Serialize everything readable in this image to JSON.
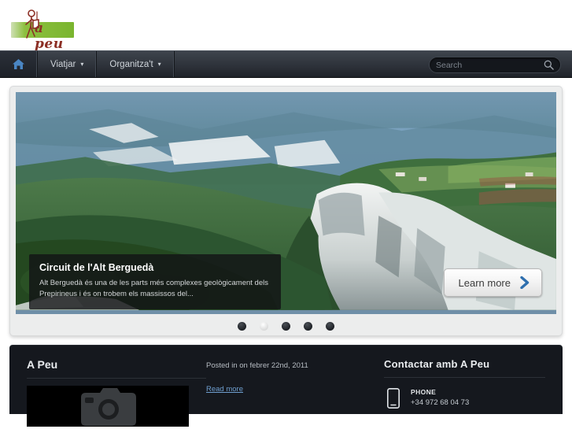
{
  "site": {
    "logo_text": "a peu",
    "logo_accent": "#7ab52f",
    "logo_ink": "#8c2f25"
  },
  "nav": {
    "home_icon": "home-icon",
    "items": [
      {
        "label": "Viatjar",
        "caret": "▾"
      },
      {
        "label": "Organitza't",
        "caret": "▾"
      }
    ]
  },
  "search": {
    "placeholder": "Search",
    "value": "",
    "icon": "search-icon"
  },
  "slider": {
    "caption_title": "Circuit de l'Alt Berguedà",
    "caption_text": "Alt Berguedà és una de les parts més complexes geològicament dels Prepirineus i és on trobem els massissos del...",
    "learn_more_label": "Learn more",
    "learn_more_icon": "chevron-right-icon",
    "arrow_color": "#2f6fae",
    "dots": [
      {
        "active": false
      },
      {
        "active": true
      },
      {
        "active": false
      },
      {
        "active": false
      },
      {
        "active": false
      }
    ]
  },
  "post": {
    "title": "A Peu",
    "thumbnail_icon": "camera-placeholder-icon",
    "meta": "Posted in on febrer 22nd, 2011",
    "read_more": "Read more"
  },
  "contact": {
    "title": "Contactar amb A Peu",
    "phone_icon": "mobile-phone-icon",
    "phone_label": "PHONE",
    "phone_number": "+34 972 68 04 73"
  }
}
